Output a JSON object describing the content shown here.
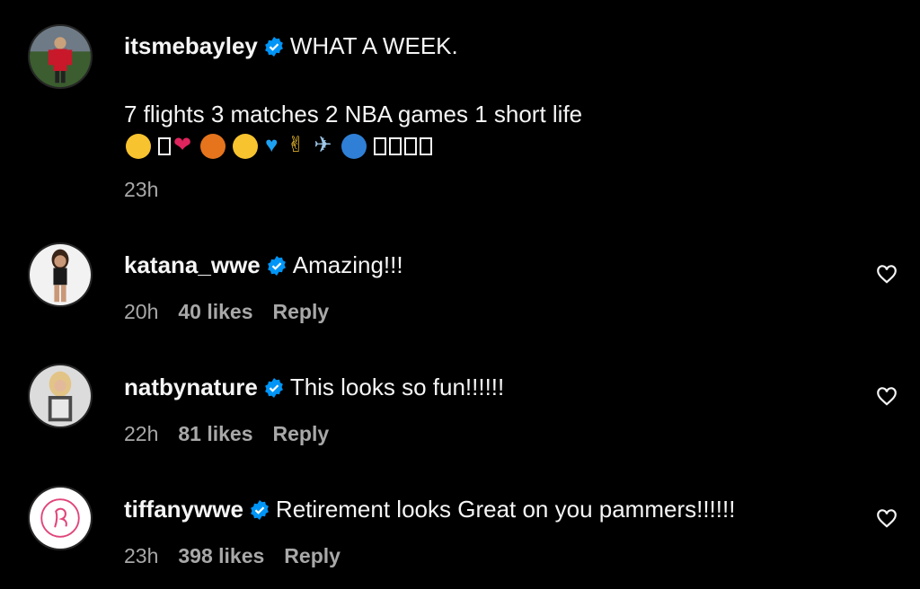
{
  "post": {
    "username": "itsmebayley",
    "title_text": "WHAT A WEEK.",
    "body_text": "7 flights 3 matches 2 NBA games 1 short life",
    "time": "23h"
  },
  "comments": [
    {
      "username": "katana_wwe",
      "text": "Amazing!!!",
      "time": "20h",
      "likes": "40 likes",
      "reply": "Reply"
    },
    {
      "username": "natbynature",
      "text": "This looks so fun!!!!!!",
      "time": "22h",
      "likes": "81 likes",
      "reply": "Reply"
    },
    {
      "username": "tiffanywwe",
      "text": "Retirement looks Great on you pammers!!!!!!",
      "time": "23h",
      "likes": "398 likes",
      "reply": "Reply"
    }
  ],
  "colors": {
    "background": "#000000",
    "verified": "#0095f6",
    "secondary_text": "#a8a8a8"
  },
  "icons": [
    "verified-badge-icon",
    "heart-outline-icon"
  ]
}
